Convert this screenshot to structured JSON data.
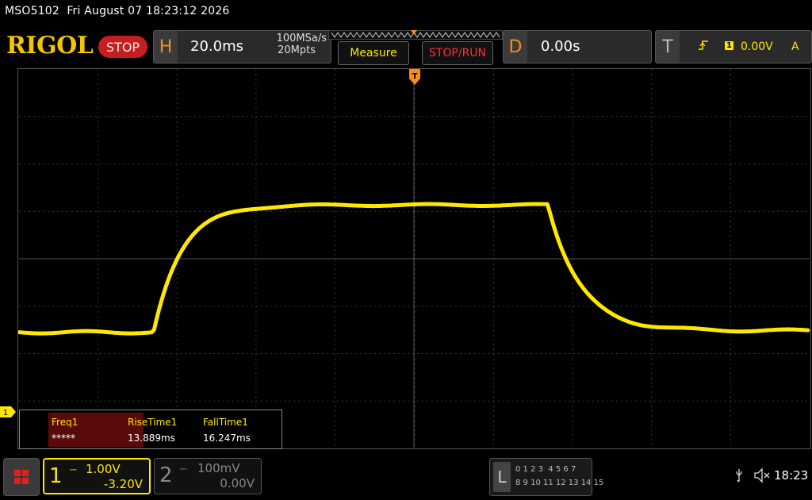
{
  "header": {
    "model": "MSO5102",
    "datetime": "Fri August 07 18:23:12 2026",
    "logo": "RIGOL",
    "run_state": "STOP"
  },
  "horizontal": {
    "letter": "H",
    "timebase": "20.0ms",
    "sample_rate": "100MSa/s",
    "memory_depth": "20Mpts"
  },
  "buttons": {
    "measure": "Measure",
    "stop_run": "STOP/RUN"
  },
  "delay": {
    "letter": "D",
    "value": "0.00s"
  },
  "trigger": {
    "letter": "T",
    "source": "1",
    "level": "0.00V",
    "mode": "A"
  },
  "measurements": [
    {
      "name": "Freq1",
      "value": "*****"
    },
    {
      "name": "RiseTime1",
      "value": "13.889ms"
    },
    {
      "name": "FallTime1",
      "value": "16.247ms"
    }
  ],
  "channels": [
    {
      "number": "1",
      "scale": "1.00V",
      "offset": "-3.20V",
      "color": "#ffe800"
    },
    {
      "number": "2",
      "scale": "100mV",
      "offset": "0.00V",
      "color": "#888888"
    }
  ],
  "logic": {
    "letter": "L",
    "row1": "0 1 2 3  4 5 6 7",
    "row2": "8 9 10 11 12 13 14 15"
  },
  "status": {
    "clock": "18:23"
  },
  "markers": {
    "ch1_marker": "1"
  },
  "colors": {
    "trace": "#ffe800",
    "accent_orange": "#ff8a1a",
    "stop_red": "#c61e1e"
  }
}
